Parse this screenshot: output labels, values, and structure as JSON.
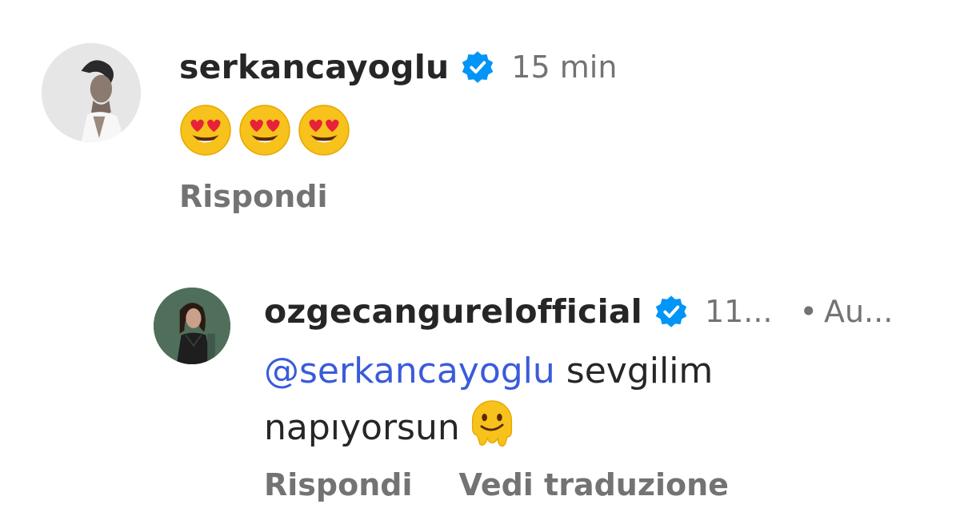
{
  "comments": [
    {
      "username": "serkancayoglu",
      "verified": true,
      "time": "15 min",
      "emojis": [
        "smiling-face-with-heart-eyes",
        "smiling-face-with-heart-eyes",
        "smiling-face-with-heart-eyes"
      ],
      "actions": {
        "reply": "Rispondi"
      }
    },
    {
      "username": "ozgecangurelofficial",
      "verified": true,
      "time": "11...",
      "separator": "•",
      "extra": "Au...",
      "mention": "@serkancayoglu",
      "text": " sevgilim napıyorsun",
      "trailing_emoji": "melting-face",
      "actions": {
        "reply": "Rispondi",
        "translate": "Vedi traduzione"
      }
    }
  ],
  "colors": {
    "username": "#262626",
    "meta": "#737373",
    "mention": "#3a5bd9",
    "verified": "#0095f6"
  }
}
